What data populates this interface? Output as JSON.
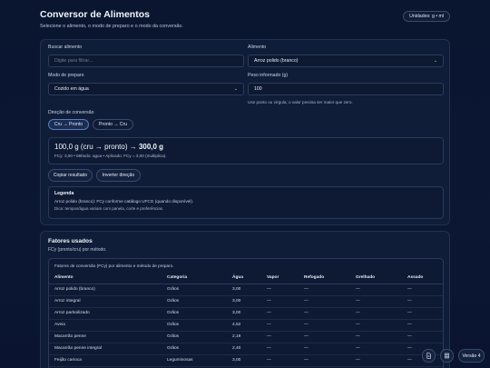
{
  "header": {
    "title": "Conversor de Alimentos",
    "subtitle": "Selecione o alimento, o modo de preparo e o modo da conversão.",
    "units_badge": "Unidades: g • ml"
  },
  "form": {
    "search_label": "Buscar alimento",
    "search_placeholder": "Digite para filtrar...",
    "food_label": "Alimento",
    "food_value": "Arroz polido (branco)",
    "mode_label": "Modo de preparo",
    "mode_value": "Cozido em água",
    "weight_label": "Peso informado (g)",
    "weight_value": "100",
    "weight_hint": "Use ponto ou vírgula; o valor precisa ser maior que zero.",
    "direction_label": "Direção de conversão",
    "direction_options": [
      "Cru → Pronto",
      "Pronto → Cru"
    ],
    "direction_selected": "Cru → Pronto"
  },
  "result": {
    "prefix": "100,0 g (cru → pronto) → ",
    "value": "300,0 g",
    "detail": "FCy: 3,00 • Método: agua • Aplicado: FCy = 3,00 (multiplica)."
  },
  "actions": {
    "copy_label": "Copiar resultado",
    "invert_label": "Inverter direção"
  },
  "legend": {
    "title": "Legenda",
    "line1": "Arroz polido (branco): FCy conforme catálogo UFCG (quando disponível).",
    "line2": "Dica: tempos/água variam com panela, corte e preferências."
  },
  "factors": {
    "title": "Fatores usados",
    "subtitle": "FCy (pronto/cru) por método.",
    "caption": "Fatores de conversão (FCy) por alimento e método de preparo.",
    "columns": [
      "Alimento",
      "Categoria",
      "Água",
      "Vapor",
      "Refogado",
      "Grelhado",
      "Assado"
    ],
    "rows": [
      [
        "Arroz polido (branco)",
        "Grãos",
        "3,00",
        "—",
        "—",
        "—",
        "—"
      ],
      [
        "Arroz integral",
        "Grãos",
        "3,00",
        "—",
        "—",
        "—",
        "—"
      ],
      [
        "Arroz parboilizado",
        "Grãos",
        "3,00",
        "—",
        "—",
        "—",
        "—"
      ],
      [
        "Aveia",
        "Grãos",
        "4,52",
        "—",
        "—",
        "—",
        "—"
      ],
      [
        "Macarrão penne",
        "Grãos",
        "2,19",
        "—",
        "—",
        "—",
        "—"
      ],
      [
        "Macarrão penne integral",
        "Grãos",
        "2,40",
        "—",
        "—",
        "—",
        "—"
      ],
      [
        "Feijão carioca",
        "Leguminosas",
        "3,00",
        "—",
        "—",
        "—",
        "—"
      ]
    ]
  },
  "footer": {
    "version_label": "Versão 4",
    "doc_icon": "document-icon",
    "table_icon": "table-icon"
  },
  "colors": {
    "background": "#0a1630",
    "card": "#121e3a",
    "accent": "#5b7bb8"
  }
}
